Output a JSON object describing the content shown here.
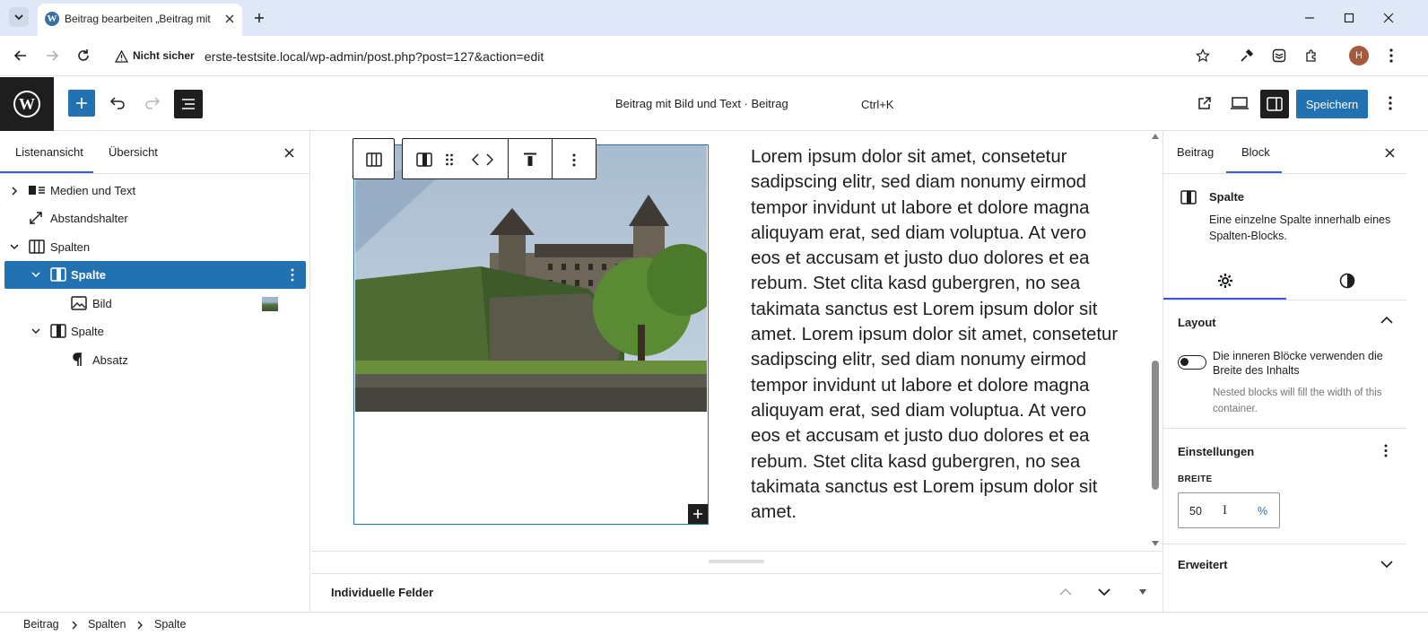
{
  "browser": {
    "tab_title": "Beitrag bearbeiten „Beitrag mit",
    "security": "Nicht sicher",
    "url": "erste-testsite.local/wp-admin/post.php?post=127&action=edit",
    "profile_initial": "H"
  },
  "header": {
    "doc_title": "Beitrag mit Bild und Text · Beitrag",
    "shortcut": "Ctrl+K",
    "save_label": "Speichern"
  },
  "left_panel": {
    "tabs": [
      "Listenansicht",
      "Übersicht"
    ],
    "tree": [
      {
        "label": "Medien und Text"
      },
      {
        "label": "Abstandshalter"
      },
      {
        "label": "Spalten"
      },
      {
        "label": "Spalte"
      },
      {
        "label": "Bild"
      },
      {
        "label": "Spalte"
      },
      {
        "label": "Absatz"
      }
    ]
  },
  "canvas": {
    "paragraph": "Lorem ipsum dolor sit amet, consetetur sadipscing elitr, sed diam nonumy eirmod tempor invidunt ut labore et dolore magna aliquyam erat, sed diam voluptua. At vero eos et accusam et justo duo dolores et ea rebum. Stet clita kasd gubergren, no sea takimata sanctus est Lorem ipsum dolor sit amet. Lorem ipsum dolor sit amet, consetetur sadipscing elitr, sed diam nonumy eirmod tempor invidunt ut labore et dolore magna aliquyam erat, sed diam voluptua. At vero eos et accusam et justo duo dolores et ea rebum. Stet clita kasd gubergren, no sea takimata sanctus est Lorem ipsum dolor sit amet."
  },
  "meta_box": {
    "label": "Individuelle Felder"
  },
  "right_panel": {
    "tabs": [
      "Beitrag",
      "Block"
    ],
    "block_name": "Spalte",
    "block_desc": "Eine einzelne Spalte innerhalb eines Spalten-Blocks.",
    "layout_title": "Layout",
    "toggle_label": "Die inneren Blöcke verwenden die Breite des Inhalts",
    "toggle_help": "Nested blocks will fill the width of this container.",
    "settings_title": "Einstellungen",
    "width_label": "BREITE",
    "width_value": "50",
    "width_unit": "%",
    "advanced_title": "Erweitert"
  },
  "breadcrumb": [
    "Beitrag",
    "Spalten",
    "Spalte"
  ],
  "colors": {
    "accent": "#3858e9",
    "wp_blue": "#2271b1",
    "selected_row": "#2271b1"
  }
}
